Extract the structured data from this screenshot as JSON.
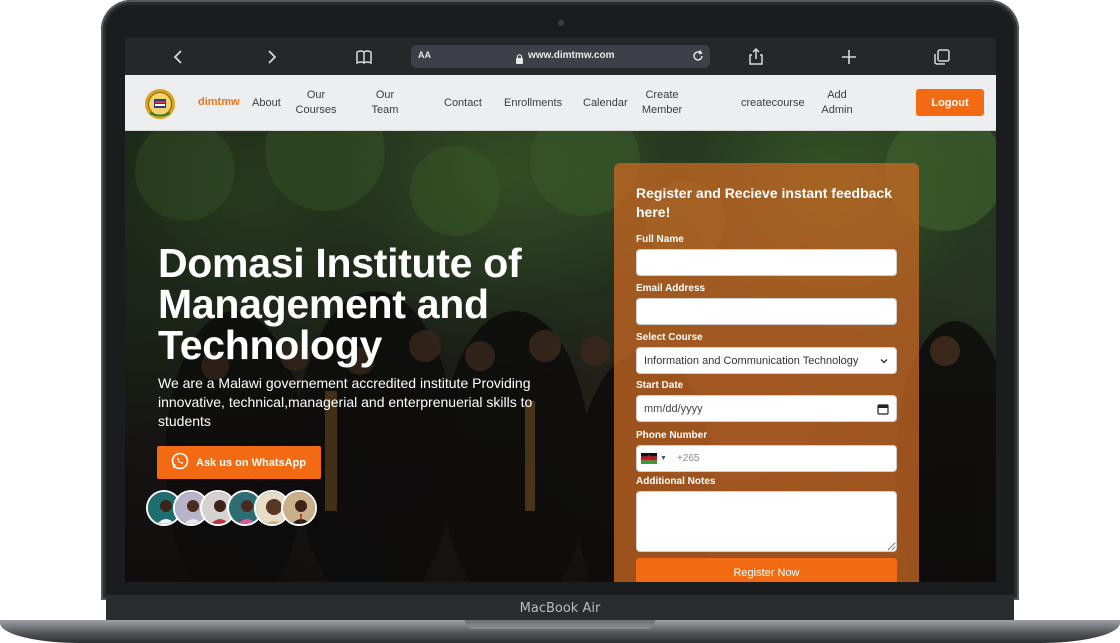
{
  "device": {
    "label": "MacBook Air"
  },
  "browser": {
    "address_prefix": "AA",
    "url": "www.dimtmw.com",
    "icons": [
      "back-icon",
      "forward-icon",
      "bookmarks-icon",
      "lock-icon",
      "reload-icon",
      "share-icon",
      "new-tab-icon",
      "tabs-icon"
    ]
  },
  "nav": {
    "brand": "dimtmw",
    "links": [
      {
        "label": "About"
      },
      {
        "label": "Our\nCourses"
      },
      {
        "label": "Our\nTeam"
      },
      {
        "label": "Contact"
      },
      {
        "label": "Enrollments"
      },
      {
        "label": "Calendar"
      },
      {
        "label": "Create\nMember"
      },
      {
        "label": "createcourse"
      },
      {
        "label": "Add\nAdmin"
      }
    ],
    "logout": "Logout"
  },
  "hero": {
    "title": "Domasi Institute of Management and Technology",
    "subtitle": "We are a Malawi governement accredited institute Providing innovative, technical,managerial and enterprenuerial skills to students",
    "whatsapp_button": "Ask us on WhatsApp"
  },
  "form": {
    "title": "Register and Recieve instant feedback here!",
    "full_name_label": "Full Name",
    "email_label": "Email Address",
    "course_label": "Select Course",
    "course_selected": "Information and Communication Technology",
    "start_date_label": "Start Date",
    "start_date_placeholder": "mm/dd/yyyy",
    "phone_label": "Phone Number",
    "phone_code": "+265",
    "notes_label": "Additional Notes",
    "submit": "Register Now"
  },
  "colors": {
    "accent": "#f26a12",
    "brand_text": "#f07318",
    "card": "#c46723",
    "nav_bg": "#eceeef",
    "toolbar_bg": "#25272b"
  }
}
